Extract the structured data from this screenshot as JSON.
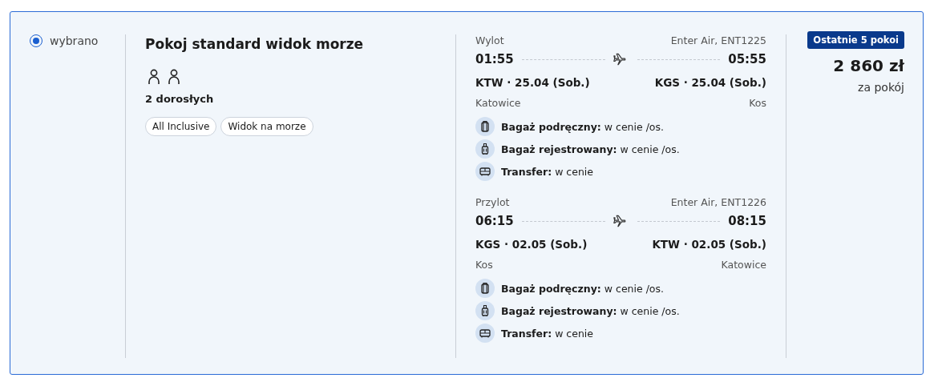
{
  "option": {
    "label": "wybrano",
    "selected": true
  },
  "room": {
    "title": "Pokoj standard widok morze",
    "guest_icons": [
      {
        "kind": "adult"
      },
      {
        "kind": "adult"
      }
    ],
    "guests": "2 dorosłych",
    "tags": [
      "All Inclusive",
      "Widok na morze"
    ]
  },
  "flights": [
    {
      "label": "Wylot",
      "carrier": "Enter Air, ENT1225",
      "depart_time": "01:55",
      "arrive_time": "05:55",
      "depart": "KTW · 25.04 (Sob.)",
      "arrive": "KGS · 25.04 (Sob.)",
      "depart_city": "Katowice",
      "arrive_city": "Kos",
      "services": [
        {
          "kind": "hand",
          "text": "**Bagaż podręczny:** w cenie /os."
        },
        {
          "kind": "checked",
          "text": "**Bagaż rejestrowany:** w cenie /os."
        },
        {
          "kind": "transfer",
          "text": "**Transfer:** w cenie"
        }
      ]
    },
    {
      "label": "Przylot",
      "carrier": "Enter Air, ENT1226",
      "depart_time": "06:15",
      "arrive_time": "08:15",
      "depart": "KGS · 02.05 (Sob.)",
      "arrive": "KTW · 02.05 (Sob.)",
      "depart_city": "Kos",
      "arrive_city": "Katowice",
      "services": [
        {
          "kind": "hand",
          "text": "**Bagaż podręczny:** w cenie /os."
        },
        {
          "kind": "checked",
          "text": "**Bagaż rejestrowany:** w cenie /os."
        },
        {
          "kind": "transfer",
          "text": "**Transfer:** w cenie"
        }
      ]
    }
  ],
  "price": {
    "badge": "Ostatnie 5 pokoi",
    "amount": "2 860 zł",
    "unit": "za pokój"
  }
}
